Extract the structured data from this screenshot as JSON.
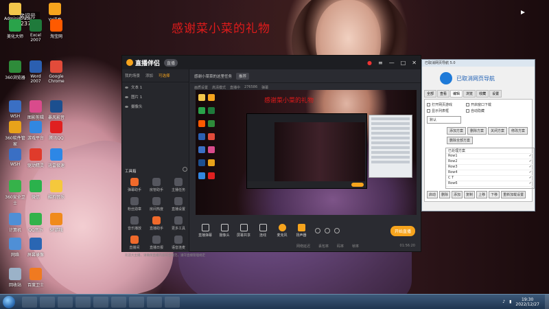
{
  "overlay_text": "感谢菜小菜的礼物",
  "room_badge": {
    "label": "房间号",
    "number": "2376"
  },
  "desktop_icons": [
    {
      "label": "Administrator",
      "color": "#f3c64b"
    },
    {
      "label": "YY语音",
      "color": "#f6a41d"
    },
    {
      "label": "美化大师",
      "color": "#2aa34a"
    },
    {
      "label": "Excel 2007",
      "color": "#1f7a3b"
    },
    {
      "label": "淘宝网",
      "color": "#ff5a00"
    },
    {
      "label": "360浏览器",
      "color": "#2e8b3a"
    },
    {
      "label": "Word 2007",
      "color": "#2b5fb0"
    },
    {
      "label": "Google Chrome",
      "color": "#e24b3a"
    },
    {
      "label": "WSH",
      "color": "#3a6fc4"
    },
    {
      "label": "图影剪辑",
      "color": "#d94b8c"
    },
    {
      "label": "暴风影音",
      "color": "#1c4f8f"
    },
    {
      "label": "360软件管家",
      "color": "#e8a21a"
    },
    {
      "label": "游戏平台",
      "color": "#3287e0"
    },
    {
      "label": "腾讯QQ",
      "color": "#e02020"
    },
    {
      "label": "WSH",
      "color": "#3a6fc4"
    },
    {
      "label": "驱动精灵",
      "color": "#e03b2b"
    },
    {
      "label": "迅雷极速",
      "color": "#2d87e6"
    },
    {
      "label": "360安全卫士",
      "color": "#36b24a"
    },
    {
      "label": "微信",
      "color": "#2bb24c"
    },
    {
      "label": "酷狗音乐",
      "color": "#f5c83c"
    },
    {
      "label": "计算机",
      "color": "#4f8fd6"
    },
    {
      "label": "QQ音乐",
      "color": "#33b24a"
    },
    {
      "label": "SF游戏",
      "color": "#f08a1c"
    },
    {
      "label": "网络",
      "color": "#4f8fd6"
    },
    {
      "label": "屏幕录像",
      "color": "#2a66b3"
    },
    {
      "label": "回收站",
      "color": "#9bb2c8"
    },
    {
      "label": "百度卫士",
      "color": "#f07a20"
    }
  ],
  "app": {
    "logo": "直播伴侣",
    "badge": "直播",
    "controls": [
      "—",
      "□",
      "✕"
    ],
    "side_tabs": [
      "我的场景",
      "添加",
      "可选择"
    ],
    "active_tab_index": 2,
    "scenes": [
      "文本 1",
      "图片 1",
      "摄像头"
    ],
    "tools_title": "工具箱",
    "tools": [
      {
        "label": "弹幕助手",
        "hot": true
      },
      {
        "label": "房管助手",
        "hot": false
      },
      {
        "label": "主播任务",
        "hot": false
      },
      {
        "label": "粉丝勋章",
        "hot": false
      },
      {
        "label": "房间热度",
        "hot": false
      },
      {
        "label": "直播设置",
        "hot": false
      },
      {
        "label": "音乐播放",
        "hot": false
      },
      {
        "label": "直播助手",
        "hot": true
      },
      {
        "label": "更多工具",
        "hot": false
      },
      {
        "label": "直播间",
        "hot": true
      },
      {
        "label": "直播日报",
        "hot": false
      },
      {
        "label": "语音连麦",
        "hot": false
      }
    ],
    "side_footer": "欢迎大主播，请确保直播内容符合规范，遵守直播管理规定",
    "top_title": "感谢小菜菜的这里任务",
    "top_pill": "推荐",
    "sub_items": [
      "画质设置",
      "高清模式",
      "直播中",
      "276586",
      "弹幕"
    ],
    "preview_overlay_text": "感谢菜小菜的礼物",
    "bottom_items": [
      "直播弹幕",
      "摄像头",
      "屏幕共享",
      "连线",
      "麦克风",
      "扬声器"
    ],
    "start_label": "开始直播",
    "status_items": [
      "网络延迟",
      "丢包率",
      "码率",
      "帧率"
    ],
    "elapsed": "01:56:20"
  },
  "helper": {
    "title": "已取消网页导航 5.0",
    "logo_text": "已取消网页导航",
    "tabs": [
      "全部",
      "查看",
      "编辑",
      "浏览",
      "收藏",
      "设置"
    ],
    "active_tab_index": 2,
    "options": [
      "打开网页游戏",
      "开启窗口下载",
      "显示列表框",
      "自动隐藏"
    ],
    "dropdown": "默认",
    "buttons": [
      "添加方案",
      "删除方案",
      "关闭方案",
      "修改方案",
      "删除全部方案"
    ],
    "list_header": "已处理方案",
    "list_rows": [
      "Row1",
      "Row2",
      "Row3",
      "Row4",
      "C T",
      "Row6"
    ],
    "footer_buttons": [
      "启动",
      "删除",
      "添加",
      "复制",
      "上移",
      "下移",
      "重新加载设置"
    ]
  },
  "taskbar": {
    "time": "19:30",
    "date": "2022/12/27",
    "buttons": [
      "ie",
      "folder",
      "media",
      "game",
      "app",
      "live",
      "chrome",
      "word",
      "win"
    ]
  }
}
